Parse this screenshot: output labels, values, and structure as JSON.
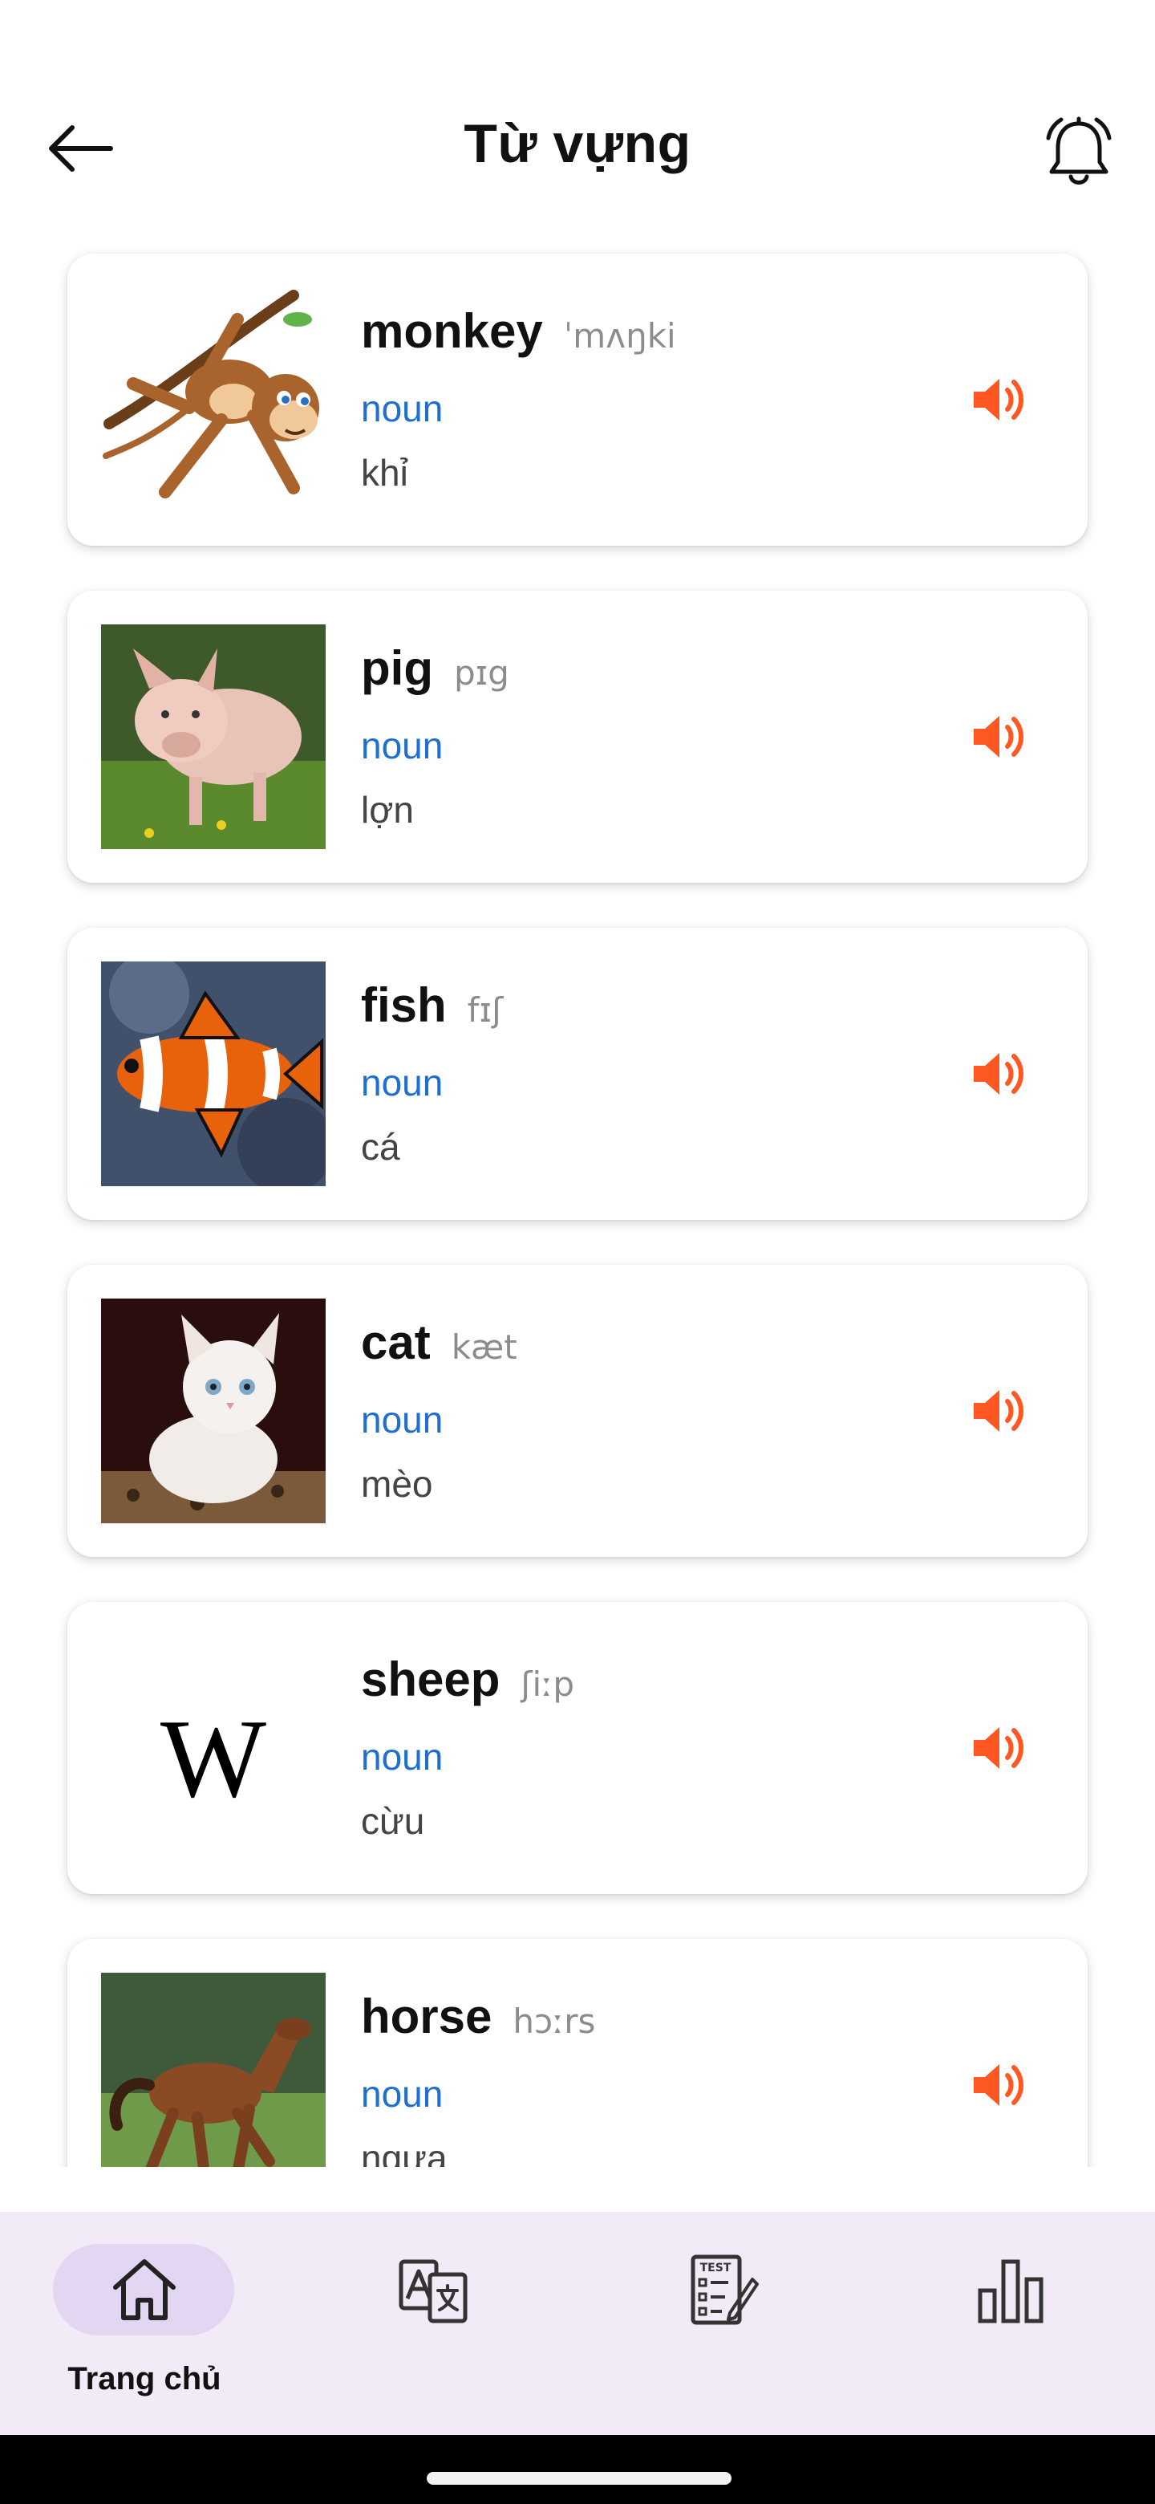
{
  "header": {
    "title": "Từ vựng",
    "back_icon": "arrow-left-icon",
    "bell_icon": "bell-icon"
  },
  "vocab": [
    {
      "word": "monkey",
      "ipa": "ˈmʌŋki",
      "pos": "noun",
      "meaning": "khỉ",
      "image": "monkey-illustration"
    },
    {
      "word": "pig",
      "ipa": "pɪg",
      "pos": "noun",
      "meaning": "lợn",
      "image": "pig-photo"
    },
    {
      "word": "fish",
      "ipa": "fɪʃ",
      "pos": "noun",
      "meaning": "cá",
      "image": "clownfish-photo"
    },
    {
      "word": "cat",
      "ipa": "kæt",
      "pos": "noun",
      "meaning": "mèo",
      "image": "kitten-photo"
    },
    {
      "word": "sheep",
      "ipa": "ʃiːp",
      "pos": "noun",
      "meaning": "cừu",
      "image": "wikipedia-w-logo"
    },
    {
      "word": "horse",
      "ipa": "hɔːrs",
      "pos": "noun",
      "meaning": "ngựa",
      "image": "horse-photo"
    }
  ],
  "wiki_logo_letter": "W",
  "nav": {
    "items": [
      {
        "label": "Trang chủ",
        "icon": "home-icon",
        "active": true
      },
      {
        "label": "",
        "icon": "translate-icon",
        "active": false
      },
      {
        "label": "",
        "icon": "test-icon",
        "active": false
      },
      {
        "label": "",
        "icon": "bar-chart-icon",
        "active": false
      }
    ],
    "test_icon_text": "TEST"
  },
  "colors": {
    "accent": "#ff5722",
    "pos_blue": "#1e6fd0",
    "nav_bg": "#f2ebf7",
    "nav_active_pill": "#e3d6f2"
  }
}
